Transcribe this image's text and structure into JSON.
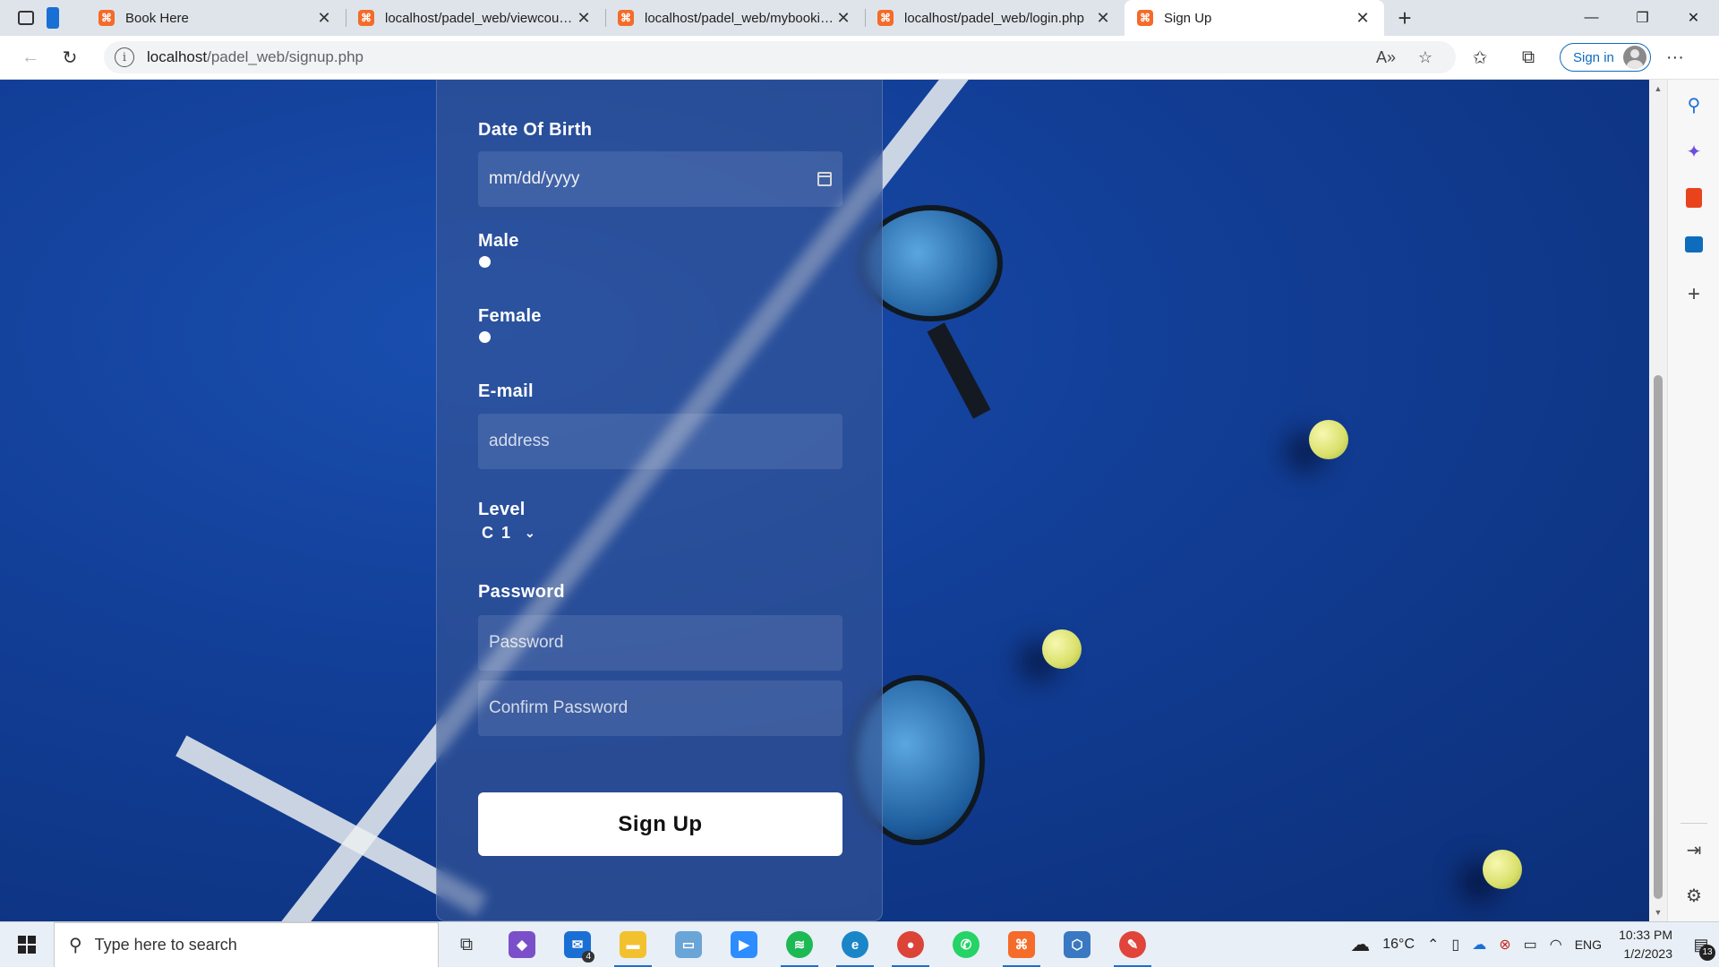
{
  "browser": {
    "tabs": [
      {
        "title": "Book Here",
        "active": false
      },
      {
        "title": "localhost/padel_web/viewcourt.php",
        "active": false
      },
      {
        "title": "localhost/padel_web/mybookings.php",
        "active": false
      },
      {
        "title": "localhost/padel_web/login.php",
        "active": false
      },
      {
        "title": "Sign Up",
        "active": true
      }
    ],
    "url_host": "localhost",
    "url_path": "/padel_web/signup.php",
    "sign_in_label": "Sign in",
    "favicon_glyph": "🏵"
  },
  "form": {
    "dob_label": "Date Of Birth",
    "dob_placeholder": "mm/dd/yyyy",
    "male_label": "Male",
    "female_label": "Female",
    "email_label": "E-mail",
    "email_placeholder": "address",
    "level_label": "Level",
    "level_value": "C 1",
    "password_label": "Password",
    "password_placeholder": "Password",
    "confirm_placeholder": "Confirm Password",
    "submit_label": "Sign Up"
  },
  "taskbar": {
    "search_placeholder": "Type here to search",
    "mail_badge": "4",
    "weather": "16°C",
    "language": "ENG",
    "time": "10:33 PM",
    "date": "1/2/2023",
    "notification_count": "13"
  },
  "colors": {
    "accent": "#0f6cbd",
    "court": "#123f98",
    "favicon": "#f46b2a"
  }
}
